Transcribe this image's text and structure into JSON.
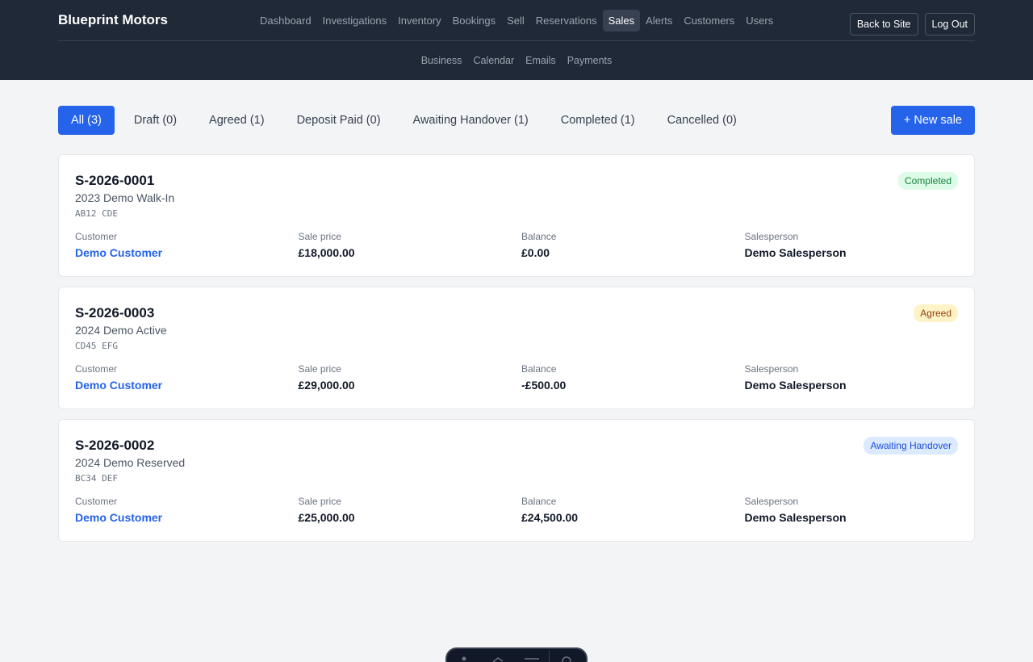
{
  "header": {
    "brand": "Blueprint Motors",
    "nav": [
      "Dashboard",
      "Investigations",
      "Inventory",
      "Bookings",
      "Sell",
      "Reservations",
      "Sales",
      "Alerts",
      "Customers",
      "Users"
    ],
    "active_nav": "Sales",
    "subnav": [
      "Business",
      "Calendar",
      "Emails",
      "Payments"
    ],
    "back_label": "Back to Site",
    "logout_label": "Log Out"
  },
  "filters": [
    "All (3)",
    "Draft (0)",
    "Agreed (1)",
    "Deposit Paid (0)",
    "Awaiting Handover (1)",
    "Completed (1)",
    "Cancelled (0)"
  ],
  "active_filter": "All (3)",
  "new_sale_label": "+ New sale",
  "labels": {
    "customer": "Customer",
    "price": "Sale price",
    "balance": "Balance",
    "salesperson": "Salesperson"
  },
  "sales": [
    {
      "ref": "S-2026-0001",
      "vehicle": "2023 Demo Walk-In",
      "plate": "AB12 CDE",
      "status": "Completed",
      "status_bg": "#dcfce7",
      "status_fg": "#15803d",
      "customer": "Demo Customer",
      "price": "£18,000.00",
      "balance": "£0.00",
      "salesperson": "Demo Salesperson"
    },
    {
      "ref": "S-2026-0003",
      "vehicle": "2024 Demo Active",
      "plate": "CD45 EFG",
      "status": "Agreed",
      "status_bg": "#fef3c7",
      "status_fg": "#92400e",
      "customer": "Demo Customer",
      "price": "£29,000.00",
      "balance": "-£500.00",
      "salesperson": "Demo Salesperson"
    },
    {
      "ref": "S-2026-0002",
      "vehicle": "2024 Demo Reserved",
      "plate": "BC34 DEF",
      "status": "Awaiting Handover",
      "status_bg": "#dbeafe",
      "status_fg": "#1d4ed8",
      "customer": "Demo Customer",
      "price": "£25,000.00",
      "balance": "£24,500.00",
      "salesperson": "Demo Salesperson"
    }
  ],
  "dock_icons": [
    "person-icon",
    "hand-pointer-icon",
    "menu-icon",
    "gear-icon"
  ]
}
